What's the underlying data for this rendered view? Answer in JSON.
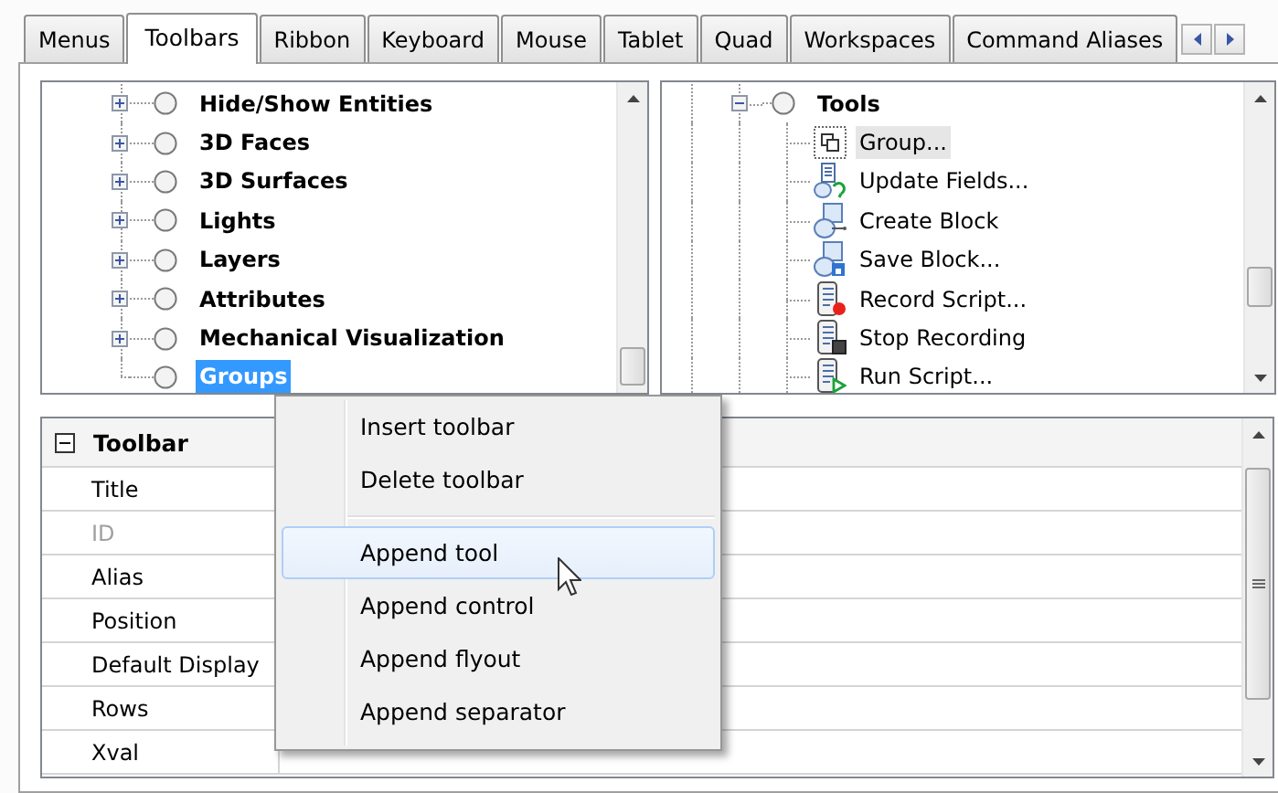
{
  "tabs": [
    {
      "label": "Menus",
      "selected": false
    },
    {
      "label": "Toolbars",
      "selected": true
    },
    {
      "label": "Ribbon",
      "selected": false
    },
    {
      "label": "Keyboard",
      "selected": false
    },
    {
      "label": "Mouse",
      "selected": false
    },
    {
      "label": "Tablet",
      "selected": false
    },
    {
      "label": "Quad",
      "selected": false
    },
    {
      "label": "Workspaces",
      "selected": false
    },
    {
      "label": "Command Aliases",
      "selected": false
    }
  ],
  "toolbar_tree": {
    "items": [
      {
        "label": "Hide/Show Entities",
        "has_children": true,
        "selected": false
      },
      {
        "label": "3D Faces",
        "has_children": true,
        "selected": false
      },
      {
        "label": "3D Surfaces",
        "has_children": true,
        "selected": false
      },
      {
        "label": "Lights",
        "has_children": true,
        "selected": false
      },
      {
        "label": "Layers",
        "has_children": true,
        "selected": false
      },
      {
        "label": "Attributes",
        "has_children": true,
        "selected": false
      },
      {
        "label": "Mechanical Visualization",
        "has_children": true,
        "selected": false
      },
      {
        "label": "Groups",
        "has_children": false,
        "selected": true
      }
    ]
  },
  "tools_tree": {
    "label": "Tools",
    "expanded": true,
    "children": [
      {
        "label": "Group...",
        "selected": true
      },
      {
        "label": "Update Fields...",
        "selected": false
      },
      {
        "label": "Create Block",
        "selected": false
      },
      {
        "label": "Save Block...",
        "selected": false
      },
      {
        "label": "Record Script...",
        "selected": false
      },
      {
        "label": "Stop Recording",
        "selected": false
      },
      {
        "label": "Run Script...",
        "selected": false
      }
    ]
  },
  "property_grid": {
    "category": "Toolbar",
    "expanded": true,
    "rows": [
      {
        "name": "Title",
        "disabled": false
      },
      {
        "name": "ID",
        "disabled": true
      },
      {
        "name": "Alias",
        "disabled": false
      },
      {
        "name": "Position",
        "disabled": false
      },
      {
        "name": "Default Display",
        "disabled": false
      },
      {
        "name": "Rows",
        "disabled": false
      },
      {
        "name": "Xval",
        "disabled": false
      }
    ]
  },
  "context_menu": {
    "sections": [
      {
        "items": [
          {
            "label": "Insert toolbar",
            "selected": false
          },
          {
            "label": "Delete toolbar",
            "selected": false
          }
        ]
      },
      {
        "items": [
          {
            "label": "Append tool",
            "selected": true
          },
          {
            "label": "Append control",
            "selected": false
          },
          {
            "label": "Append flyout",
            "selected": false
          },
          {
            "label": "Append separator",
            "selected": false
          }
        ]
      }
    ]
  }
}
